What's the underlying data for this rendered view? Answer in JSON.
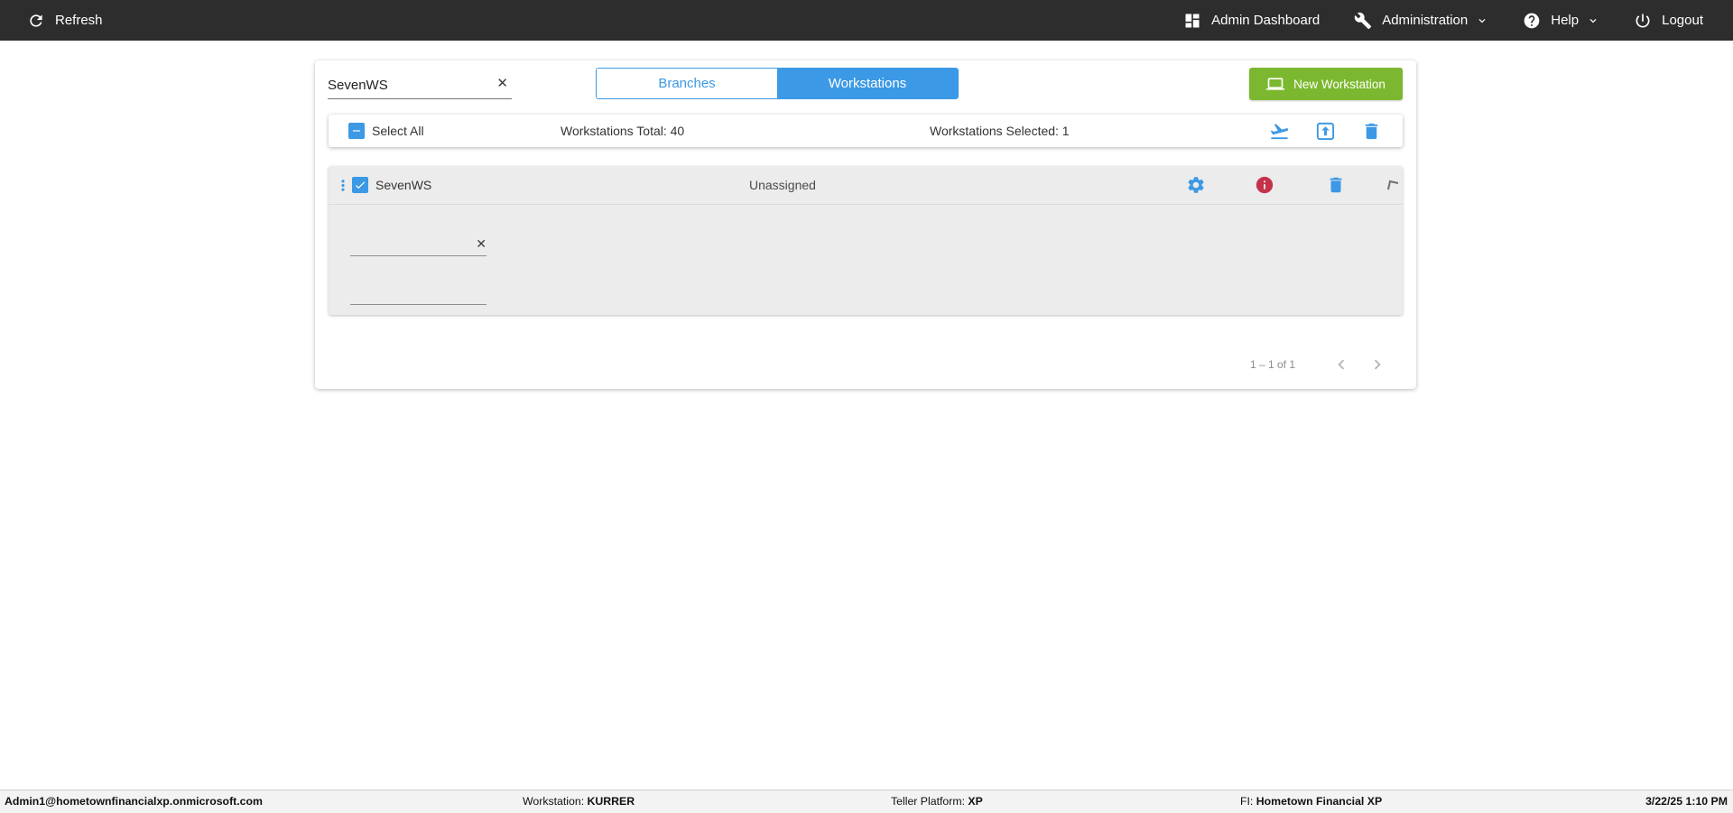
{
  "topbar": {
    "refresh_label": "Refresh",
    "admin_dashboard_label": "Admin Dashboard",
    "administration_label": "Administration",
    "help_label": "Help",
    "logout_label": "Logout"
  },
  "header": {
    "search_value": "SevenWS",
    "tabs": [
      {
        "label": "Branches",
        "active": false
      },
      {
        "label": "Workstations",
        "active": true
      }
    ],
    "new_workstation_label": "New Workstation"
  },
  "toolbar": {
    "select_all_label": "Select All",
    "total_label": "Workstations Total: 40",
    "selected_label": "Workstations Selected: 1"
  },
  "workstation": {
    "name": "SevenWS",
    "assignment": "Unassigned",
    "field1_value": "",
    "field2_value": ""
  },
  "pagination": {
    "range_label": "1 – 1 of 1"
  },
  "statusbar": {
    "user": "Admin1@hometownfinancialxp.onmicrosoft.com",
    "workstation_label": "Workstation: ",
    "workstation_value": "KURRER",
    "teller_label": "Teller Platform: ",
    "teller_value": "XP",
    "fi_label": "FI: ",
    "fi_value": "Hometown Financial XP",
    "datetime": "3/22/25 1:10 PM"
  },
  "icons": {
    "clear": "✕"
  },
  "colors": {
    "topbar_bg": "#2d2d2d",
    "accent_blue": "#3b99e5",
    "button_green": "#7cb82f",
    "info_red": "#c5334a",
    "card_gray": "#ececec"
  }
}
